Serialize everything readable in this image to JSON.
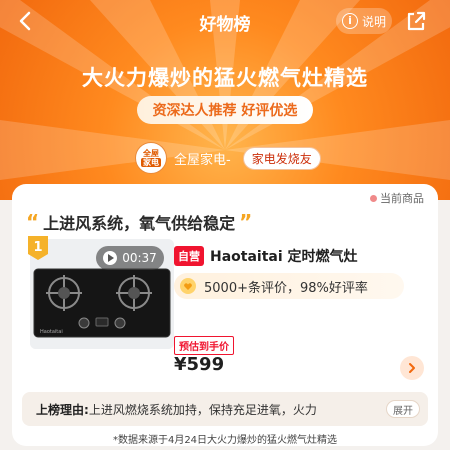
{
  "header": {
    "title": "好物榜",
    "explain_label": "说明",
    "headline": "大火力爆炒的猛火燃气灶精选",
    "subtitle": "资深达人推荐 好评优选"
  },
  "category": {
    "logo_top": "全屋",
    "logo_bottom": "家电",
    "name": "全屋家电-",
    "tag": "家电发烧友"
  },
  "card": {
    "current_label": "当前商品",
    "section_title": "上进风系统，氧气供给稳定",
    "rank": "1",
    "video_duration": "00:37",
    "badge": "自营",
    "product_name": "Haotaitai 定时燃气灶",
    "reviews": "5000+条评价，98%好评率",
    "price_label": "预估到手价",
    "price": "¥599",
    "reason_label": "上榜理由:",
    "reason_text": "上进风燃烧系统加持，保持充足进氧，火力",
    "expand_label": "展开",
    "brand_mark": "Haotaitai"
  },
  "footnote": "*数据来源于4月24日大火力爆炒的猛火燃气灶精选",
  "colors": {
    "accent": "#f2690e",
    "price_red": "#f0142f",
    "gold": "#f5a623"
  }
}
